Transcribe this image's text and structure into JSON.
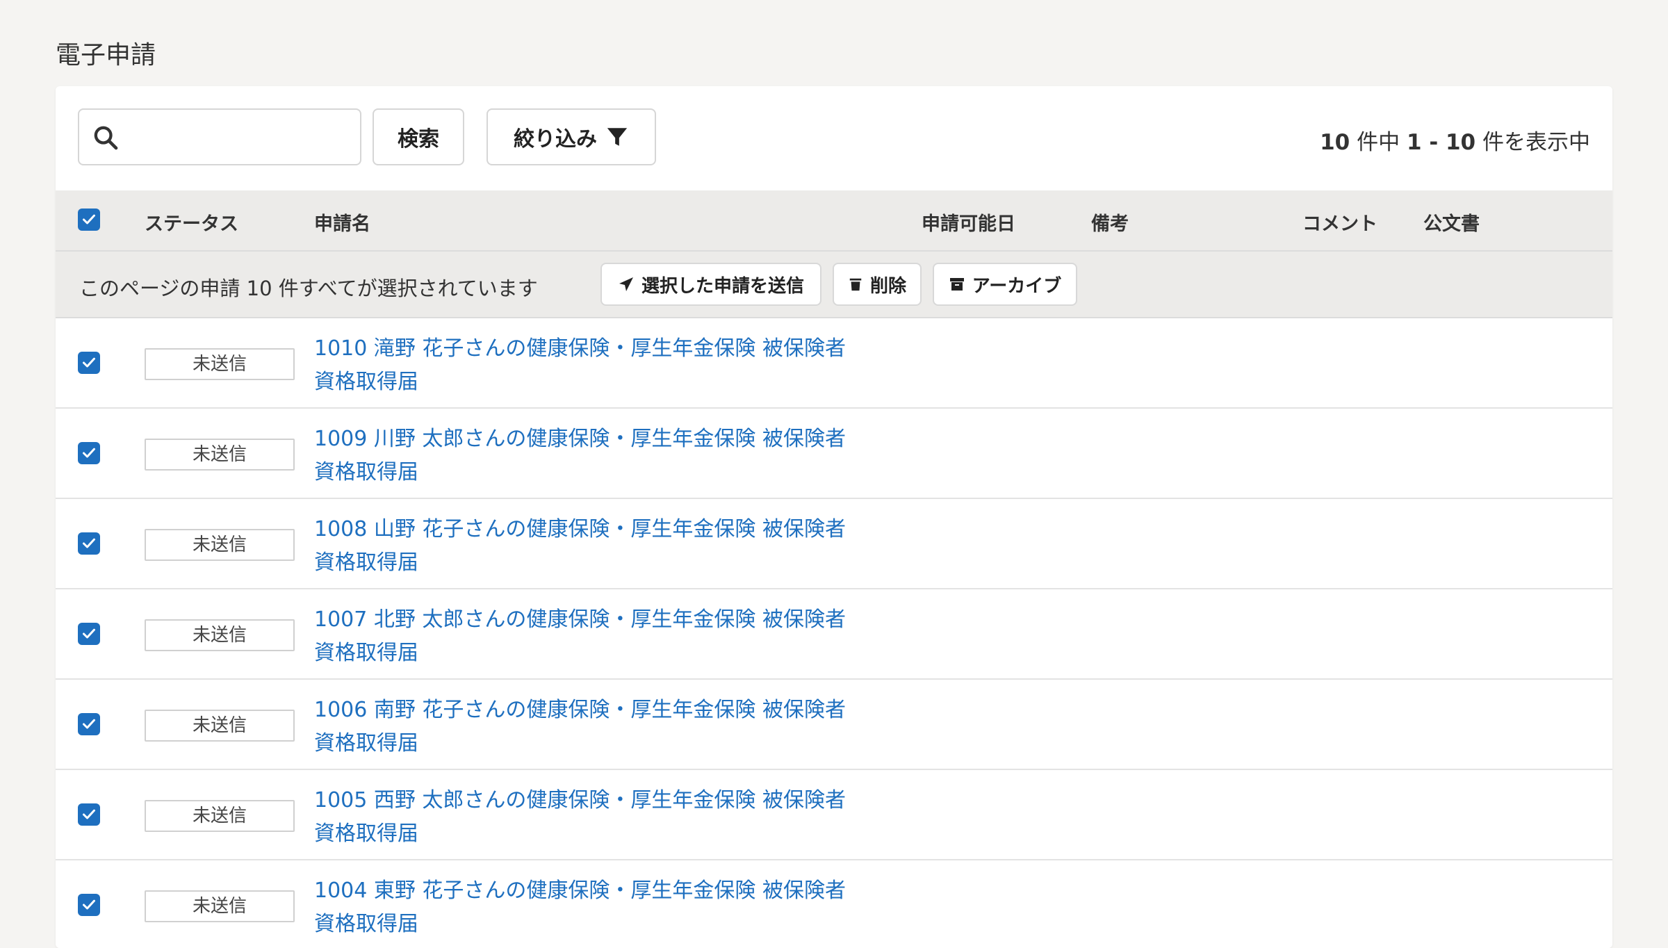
{
  "page": {
    "title": "電子申請"
  },
  "toolbar": {
    "search_placeholder": "",
    "search_button": "検索",
    "filter_button": "絞り込み",
    "count": {
      "total": "10",
      "mid1": " 件中 ",
      "range": "1 - 10",
      "suffix": " 件を表示中"
    }
  },
  "table": {
    "columns": {
      "status": "ステータス",
      "name": "申請名",
      "available_date": "申請可能日",
      "notes": "備考",
      "comment": "コメント",
      "official_doc": "公文書"
    },
    "selection_bar": {
      "message": "このページの申請 10 件すべてが選択されています",
      "send_button": "選択した申請を送信",
      "delete_button": "削除",
      "archive_button": "アーカイブ"
    },
    "rows": [
      {
        "status": "未送信",
        "title_line1": "1010 滝野 花子さんの健康保険・厚生年金保険 被保険者",
        "title_line2": "資格取得届"
      },
      {
        "status": "未送信",
        "title_line1": "1009 川野 太郎さんの健康保険・厚生年金保険 被保険者",
        "title_line2": "資格取得届"
      },
      {
        "status": "未送信",
        "title_line1": "1008 山野 花子さんの健康保険・厚生年金保険 被保険者",
        "title_line2": "資格取得届"
      },
      {
        "status": "未送信",
        "title_line1": "1007 北野 太郎さんの健康保険・厚生年金保険 被保険者",
        "title_line2": "資格取得届"
      },
      {
        "status": "未送信",
        "title_line1": "1006 南野 花子さんの健康保険・厚生年金保険 被保険者",
        "title_line2": "資格取得届"
      },
      {
        "status": "未送信",
        "title_line1": "1005 西野 太郎さんの健康保険・厚生年金保険 被保険者",
        "title_line2": "資格取得届"
      },
      {
        "status": "未送信",
        "title_line1": "1004 東野 花子さんの健康保険・厚生年金保険 被保険者",
        "title_line2": "資格取得届"
      }
    ]
  },
  "colors": {
    "accent": "#1e6fbf",
    "header_bg": "#ecebe9",
    "page_bg": "#f5f4f2"
  },
  "icons": [
    "search-icon",
    "filter-icon",
    "send-icon",
    "trash-icon",
    "archive-icon",
    "checkbox-checked-icon"
  ]
}
